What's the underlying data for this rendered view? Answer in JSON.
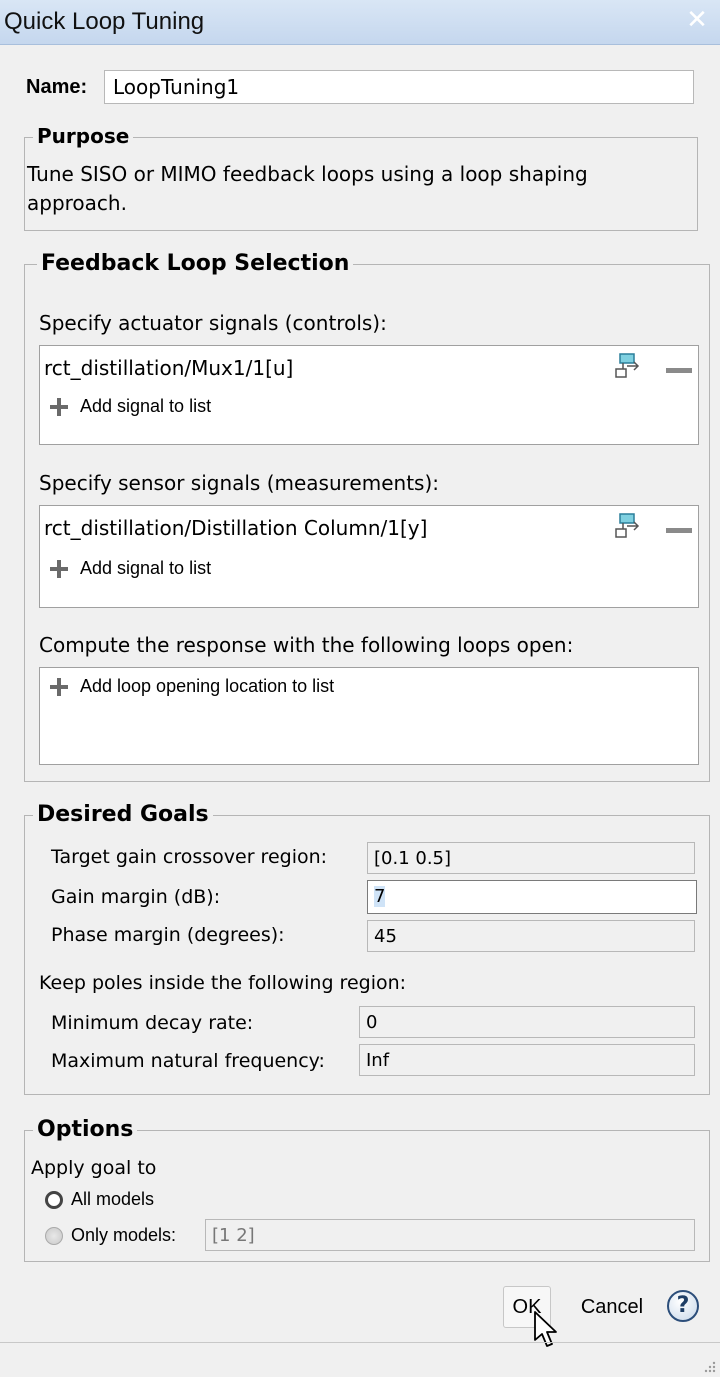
{
  "window": {
    "title": "Quick Loop Tuning",
    "close_glyph": "✕"
  },
  "name": {
    "label": "Name:",
    "value": "LoopTuning1"
  },
  "purpose": {
    "legend": "Purpose",
    "text_line1": "Tune SISO or MIMO feedback loops using a loop shaping",
    "text_line2": "approach."
  },
  "feedback": {
    "legend": "Feedback Loop Selection",
    "actuator_label": "Specify actuator signals (controls):",
    "actuator_signal": "rct_distillation/Mux1/1[u]",
    "actuator_add": "Add signal to list",
    "sensor_label": "Specify sensor signals (measurements):",
    "sensor_signal": "rct_distillation/Distillation Column/1[y]",
    "sensor_add": "Add signal to list",
    "open_label": "Compute the response with the following loops open:",
    "open_add": "Add loop opening location to list"
  },
  "goals": {
    "legend": "Desired Goals",
    "crossover_label": "Target gain crossover region:",
    "crossover_value": "[0.1 0.5]",
    "gain_margin_label": "Gain margin (dB):",
    "gain_margin_value": "7",
    "phase_margin_label": "Phase margin (degrees):",
    "phase_margin_value": "45",
    "poles_label": "Keep poles inside the following region:",
    "min_decay_label": "Minimum decay rate:",
    "min_decay_value": "0",
    "max_freq_label": "Maximum natural frequency:",
    "max_freq_value": "Inf"
  },
  "options": {
    "legend": "Options",
    "apply_label": "Apply goal to",
    "all_models_label": "All models",
    "all_models_selected": true,
    "only_models_label": "Only models:",
    "only_models_value": "[1 2]"
  },
  "buttons": {
    "ok": "OK",
    "cancel": "Cancel",
    "help": "?"
  },
  "icons": {
    "select_signal": "signal-select-icon",
    "remove_signal": "minus-icon",
    "add": "plus-icon",
    "help": "help-icon",
    "cursor": "mouse-pointer-icon",
    "grip": "resize-grip-icon"
  }
}
